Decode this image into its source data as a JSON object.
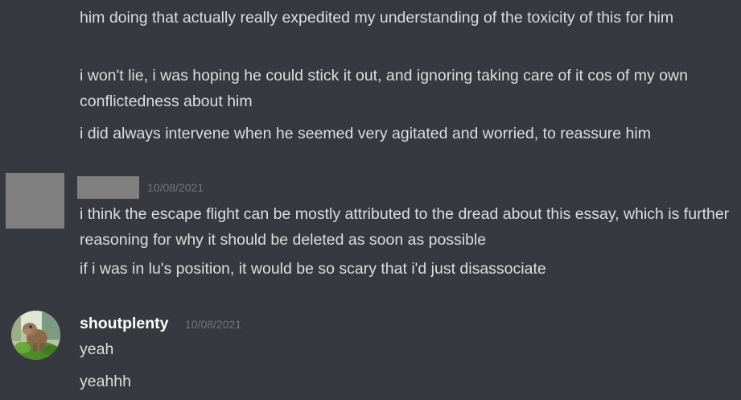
{
  "messages": {
    "group1": {
      "lines": [
        "him doing that actually really expedited my understanding of the toxicity of this for him",
        "i won't lie, i was hoping he could stick it out, and ignoring taking care of it cos of my own conflictedness about him",
        "i did always intervene when he seemed very agitated and worried, to reassure him"
      ]
    },
    "group2": {
      "timestamp": "10/08/2021",
      "lines": [
        "i think the escape flight can be mostly attributed to the dread about this essay, which is further reasoning for why it should be deleted as soon as possible",
        "if i was in lu's position, it would be so scary that i'd just disassociate"
      ]
    },
    "group3": {
      "username": "shoutplenty",
      "timestamp": "10/08/2021",
      "lines": [
        "yeah",
        "yeahhh"
      ]
    }
  },
  "colors": {
    "background": "#36393f",
    "text": "#dcddde",
    "username": "#ffffff",
    "timestamp": "#72767d",
    "redacted": "#808080"
  },
  "icons": {
    "group2_avatar": "redacted-avatar-icon",
    "group3_avatar": "user-avatar-icon"
  }
}
